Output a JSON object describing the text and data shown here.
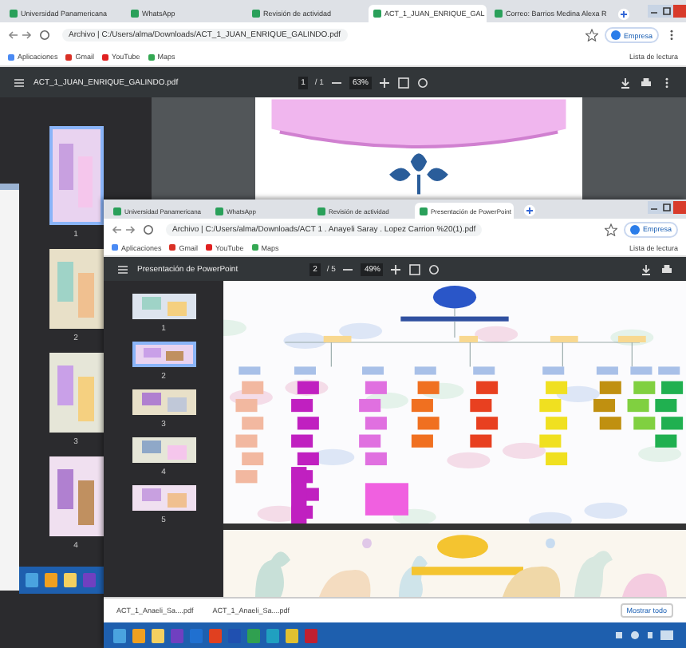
{
  "back_window": {
    "tabs": [
      {
        "label": "Universidad Panamericana",
        "selected": false
      },
      {
        "label": "WhatsApp",
        "selected": false
      },
      {
        "label": "Revisión de actividad",
        "selected": false
      },
      {
        "label": "ACT_1_JUAN_ENRIQUE_GAL",
        "selected": true
      },
      {
        "label": "Correo: Barrios Medina Alexa R",
        "selected": false
      }
    ],
    "address": "Archivo | C:/Users/alma/Downloads/ACT_1_JUAN_ENRIQUE_GALINDO.pdf",
    "profile": "Empresa",
    "bookmarks": [
      "Aplicaciones",
      "Gmail",
      "YouTube",
      "Maps"
    ],
    "reading_list": "Lista de lectura",
    "pdf": {
      "title": "ACT_1_JUAN_ENRIQUE_GALINDO.pdf",
      "page": "1",
      "pages": "/ 1",
      "zoom": "63%"
    },
    "thumbnails": [
      {
        "number": "1",
        "selected": true
      },
      {
        "number": "2",
        "selected": false
      },
      {
        "number": "3",
        "selected": false
      },
      {
        "number": "4",
        "selected": false
      }
    ]
  },
  "front_window": {
    "tabs": [
      {
        "label": "Universidad Panamericana",
        "selected": false
      },
      {
        "label": "WhatsApp",
        "selected": false
      },
      {
        "label": "Revisión de actividad",
        "selected": false
      },
      {
        "label": "Presentación de PowerPoint",
        "selected": true
      }
    ],
    "address": "Archivo | C:/Users/alma/Downloads/ACT 1 . Anayeli Saray . Lopez Carrion %20(1).pdf",
    "profile": "Empresa",
    "bookmarks": [
      "Aplicaciones",
      "Gmail",
      "YouTube",
      "Maps"
    ],
    "reading_list": "Lista de lectura",
    "pdf": {
      "title": "Presentación de PowerPoint",
      "page": "2",
      "pages": "/ 5",
      "zoom": "49%"
    },
    "thumbnails": [
      {
        "number": "1",
        "selected": false
      },
      {
        "number": "2",
        "selected": true
      },
      {
        "number": "3",
        "selected": false
      },
      {
        "number": "4",
        "selected": false
      },
      {
        "number": "5",
        "selected": false
      }
    ],
    "downloads": [
      "ACT_1_Anaeli_Sa....pdf",
      "ACT_1_Anaeli_Sa....pdf"
    ],
    "show_all": "Mostrar todo"
  }
}
